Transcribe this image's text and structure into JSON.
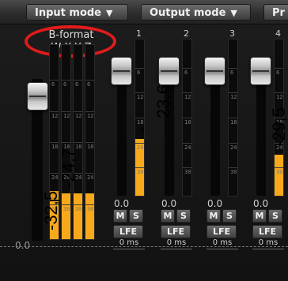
{
  "toolbar": {
    "input_mode_label": "Input mode",
    "output_mode_label": "Output mode",
    "third_label": "Pr",
    "dropdown_glyph": "▼"
  },
  "input_section": {
    "title": "B-format",
    "channels": "W X Y Z",
    "fader_value": "0.0",
    "ring_color": "#e31b1b"
  },
  "meter_scale": {
    "labels": [
      "6",
      "12",
      "18",
      "24",
      "30"
    ]
  },
  "outputs": [
    {
      "number": "1",
      "value": "0.0",
      "mute": "M",
      "solo": "S",
      "lfe": "LFE",
      "delay": "0 ms"
    },
    {
      "number": "2",
      "value": "0.0",
      "mute": "M",
      "solo": "S",
      "lfe": "LFE",
      "delay": "0 ms"
    },
    {
      "number": "3",
      "value": "0.0",
      "mute": "M",
      "solo": "S",
      "lfe": "LFE",
      "delay": "0 ms"
    },
    {
      "number": "4",
      "value": "0.0",
      "mute": "M",
      "solo": "S",
      "lfe": "LFE",
      "delay": "0 ms"
    }
  ],
  "overlay_labels": {
    "a": "-32,5",
    "b": "-24,7",
    "c": "23,6",
    "d": "-",
    "e": "-29,5"
  },
  "colors": {
    "meter_fill": "#f7a81b",
    "background": "#151515"
  }
}
